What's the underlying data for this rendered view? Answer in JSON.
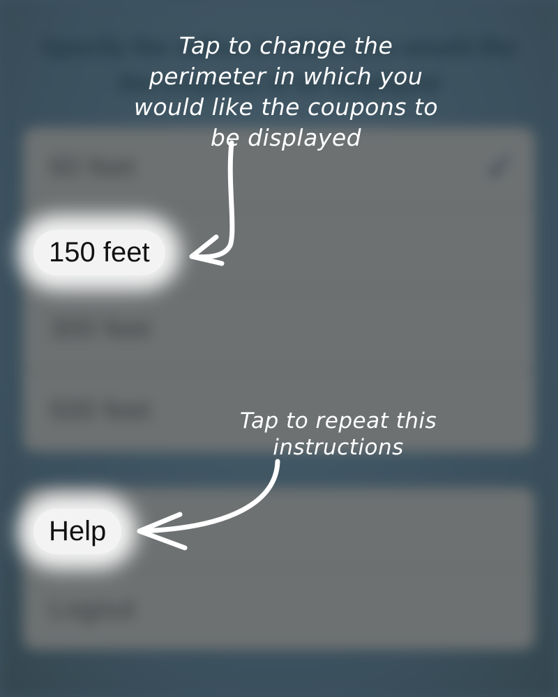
{
  "background": {
    "intro_text": "Specify the radius in which you would like the coupons to be displayed"
  },
  "radius_options": [
    {
      "label": "60 feet",
      "selected": true
    },
    {
      "label": "150 feet",
      "selected": false
    },
    {
      "label": "300 feet",
      "selected": false
    },
    {
      "label": "500 feet",
      "selected": false
    }
  ],
  "account_options": [
    {
      "label": "Help"
    },
    {
      "label": "Logout"
    }
  ],
  "annotations": {
    "perimeter": "Tap to change the perimeter in which you would like the coupons to be displayed",
    "help": "Tap to repeat this instructions"
  },
  "colors": {
    "background": "#3d5260",
    "group": "#6d7172",
    "annotation": "#ffffff",
    "highlight": "#f3f3f3"
  },
  "icons": {
    "selected": "checkmark-icon"
  }
}
